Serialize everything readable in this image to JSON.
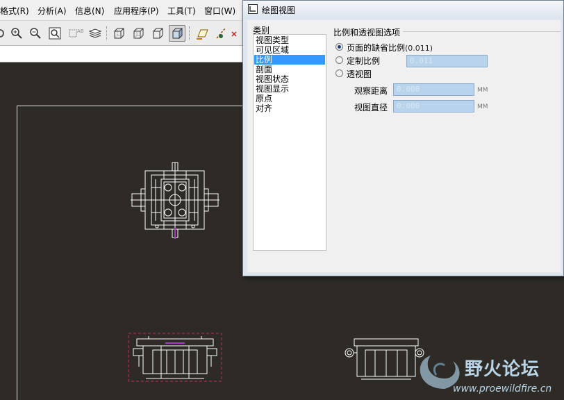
{
  "app": {
    "menus": [
      "格式(R)",
      "分析(A)",
      "信息(N)",
      "应用程序(P)",
      "工具(T)",
      "窗口(W)"
    ],
    "toolbar_icons": [
      "zoom-in-icon",
      "zoom-out-icon",
      "refit-icon",
      "orient-icon",
      "layers-icon",
      "view-wireframe-icon",
      "view-hidden-icon",
      "view-no-hidden-icon",
      "view-shaded-icon",
      "datum-plane-icon",
      "datum-axis-icon",
      "datum-point-icon"
    ]
  },
  "dialog": {
    "title": "绘图视图",
    "category_label": "类别",
    "categories": [
      "视图类型",
      "可见区域",
      "比例",
      "剖面",
      "视图状态",
      "视图显示",
      "原点",
      "对齐"
    ],
    "selected_category": "比例",
    "group_title": "比例和透视图选项",
    "options": {
      "default_scale_label": "页面的缺省比例",
      "default_scale_value": "(0.011)",
      "custom_scale_label": "定制比例",
      "custom_scale_value": "0.011",
      "perspective_label": "透视图"
    },
    "selected_option": "default_scale",
    "perspective": {
      "viewing_distance_label": "观察距离",
      "viewing_distance_value": "0.000",
      "view_diameter_label": "视图直径",
      "view_diameter_value": "0.000",
      "unit": "MM"
    }
  },
  "watermark": {
    "title": "野火论坛",
    "url": "www.proewildfire.cn"
  },
  "colors": {
    "canvas": "#2e2b27",
    "geometry": "#ffffff",
    "selection": "#c0305a",
    "highlight": "#a040c0",
    "list_selection": "#3399ff"
  }
}
